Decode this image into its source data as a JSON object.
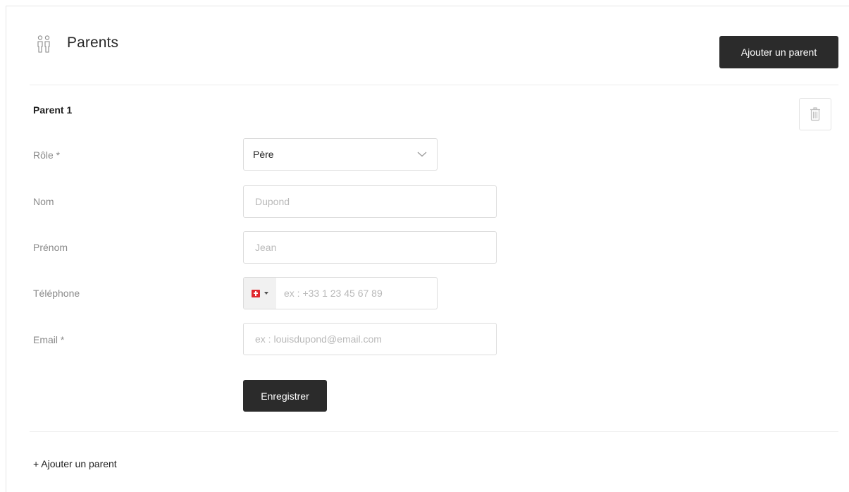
{
  "header": {
    "title": "Parents",
    "icon": "parents-icon",
    "add_button_label": "Ajouter un parent"
  },
  "parent_section": {
    "title": "Parent 1",
    "delete_icon": "trash-icon",
    "fields": {
      "role": {
        "label": "Rôle *",
        "value": "Père",
        "icon": "chevron-down-icon"
      },
      "nom": {
        "label": "Nom",
        "value": "",
        "placeholder": "Dupond"
      },
      "prenom": {
        "label": "Prénom",
        "value": "",
        "placeholder": "Jean"
      },
      "telephone": {
        "label": "Téléphone",
        "value": "",
        "placeholder": "ex : +33 1 23 45 67 89",
        "country_flag": "swiss-flag-icon"
      },
      "email": {
        "label": "Email *",
        "value": "",
        "placeholder": "ex : louisdupond@email.com"
      }
    },
    "save_button_label": "Enregistrer"
  },
  "footer": {
    "add_link_label": "+ Ajouter un parent"
  },
  "colors": {
    "button_bg": "#2b2b2b",
    "label_text": "#8a8a8a",
    "placeholder_text": "#b9b9b9",
    "flag_red": "#e0282e"
  }
}
